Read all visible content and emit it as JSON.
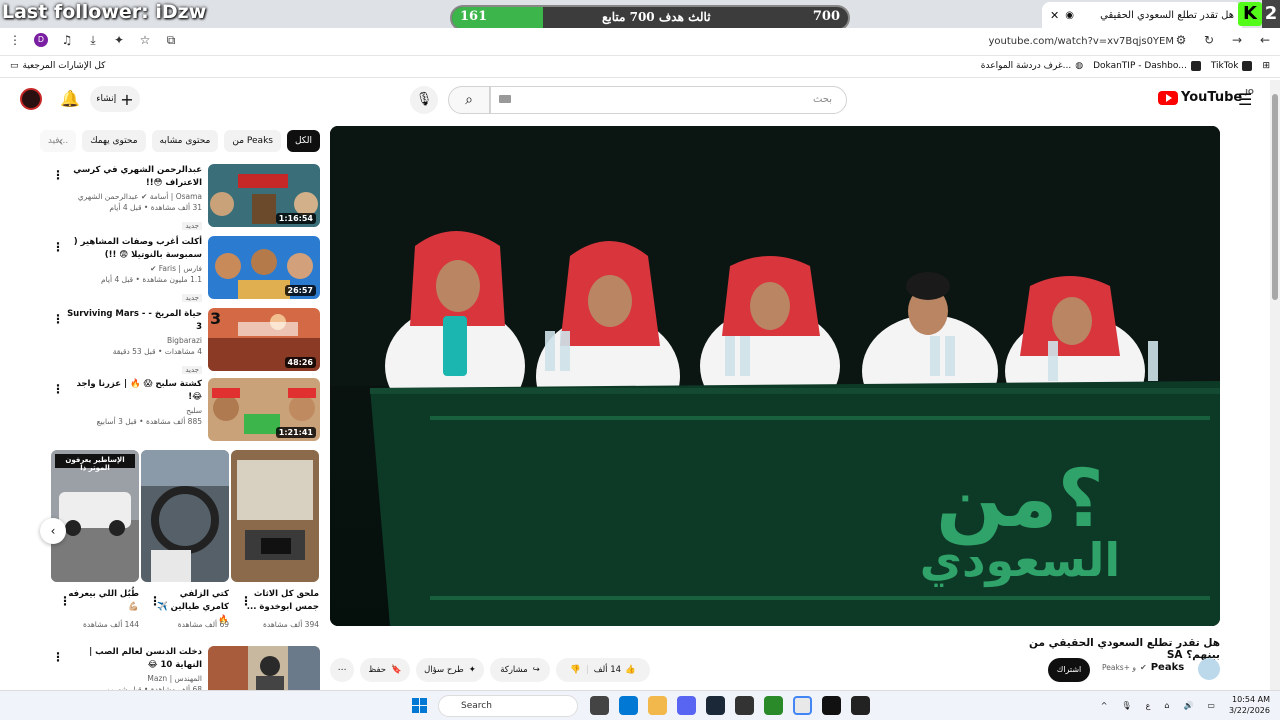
{
  "overlay": {
    "last_follower": "Last follower: iDzw",
    "goal_current": "161",
    "goal_label": "ثالث هدف 700 متابع",
    "goal_target": "700",
    "goal_progress_pct": 23,
    "corner_number": "2",
    "kick_letter": "K"
  },
  "browser": {
    "tab_title": "هل تقدر تطلع السعودي الحقيقي",
    "tab_close": "✕",
    "new_tab": "+",
    "url": "youtube.com/watch?v=xv7Bqjs0YEM",
    "profile_letter": "D",
    "bookmarks": {
      "all": "كل الإشارات المرجعية",
      "items": [
        "TikTok",
        "DokanTIP - Dashbo...",
        "غرف دردشة المواعدة..."
      ]
    }
  },
  "youtube": {
    "logo_text": "YouTube",
    "logo_country": "JO",
    "search_placeholder": "بحث",
    "create_label": "إنشاء",
    "chips": [
      "الكل",
      "من Peaks",
      "محتوى مشابه",
      "محتوى يهمك",
      "فيد..."
    ],
    "related": [
      {
        "title": "عبدالرحمن الشهري في كرسي الاعتراف 😳!!",
        "channel": "Osama | أسامة ✔ عبدالرحمن الشهري",
        "meta": "31 ألف مشاهدة • قبل 4 أيام",
        "badge": "جديد",
        "duration": "1:16:54",
        "thumb_color": "#3a6f7a"
      },
      {
        "title": "أكلت أغرب وصفات المشاهير ( سمبوسة بالنوتيلا 😨 !!)",
        "channel": "فارس | Faris ✔",
        "meta": "1.1 مليون مشاهدة • قبل 4 أيام",
        "badge": "جديد",
        "duration": "26:57",
        "thumb_color": "#2b7bd1"
      },
      {
        "title": "حياة المريخ - Surviving Mars - 3",
        "channel": "Bigbarazi",
        "meta": "4 مشاهدات • قبل 53 دقيقة",
        "badge": "جديد",
        "duration": "48:26",
        "thumb_color": "#b5472f"
      },
      {
        "title": "كشتة سلبح 😱 🔥 | عزرنا واجد 😂!",
        "channel": "سلبح",
        "meta": "885 ألف مشاهدة • قبل 3 أسابيع",
        "badge": "",
        "duration": "1:21:41",
        "thumb_color": "#c9a27a"
      },
      {
        "title": "دخلت الدنسن لعالم الصب | النهاية 10 😂",
        "channel": "المهندس | Mazn",
        "meta": "68 ألف مشاهدة • قبل شهرين",
        "badge": "",
        "duration": "",
        "thumb_color": "#a85c3c"
      }
    ],
    "shorts": [
      {
        "title": "ملحق كل الاثاث جمس ابوخدوة ...",
        "views": "394 ألف مشاهدة",
        "color": "#8a6a4a"
      },
      {
        "title": "كتي الزلفي كامري طيالين ✈️ 🔥",
        "views": "69 ألف مشاهدة",
        "color": "#556068"
      },
      {
        "title": "طُبُل اللي بيعرفه 💪🏼",
        "views": "144 ألف مشاهدة",
        "color": "#6e6e6e"
      }
    ],
    "shorts_overlay_text": "الإساطير يعرفون الموتر ذا",
    "video_title": "هل تقدر تطلع السعودي الحقيقي من بينهم؟ SA",
    "channel_name": "Peaks",
    "channel_sub": "Peaks+ و",
    "subscribe_label": "اشتراك",
    "likes": "14 ألف",
    "share_label": "مشاركة",
    "ask_label": "طرح سؤال",
    "save_label": "حفظ"
  },
  "taskbar": {
    "search_label": "Search",
    "time": "10:54 AM",
    "date": "3/22/2026",
    "lang": "ع"
  }
}
